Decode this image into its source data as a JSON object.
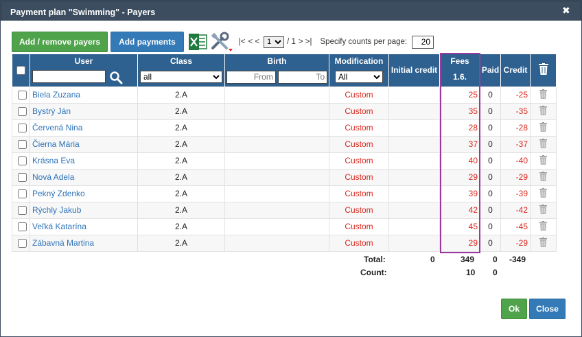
{
  "dialog": {
    "title": "Payment plan \"Swimming\" - Payers",
    "close_glyph": "✖"
  },
  "toolbar": {
    "add_remove_label": "Add / remove payers",
    "add_payments_label": "Add payments",
    "pager": {
      "first": "|<",
      "prev": "< <",
      "page_value": "1",
      "of": "/ 1",
      "next": "> >|"
    },
    "per_page_label": "Specify counts per page:",
    "per_page_value": "20"
  },
  "columns": {
    "user": "User",
    "class": "Class",
    "birth": "Birth",
    "modification": "Modification",
    "initial_credit": "Initial credit",
    "fees": "Fees",
    "fees_date": "1.6.",
    "paid": "Paid",
    "credit": "Credit"
  },
  "filters": {
    "class_value": "all",
    "birth_from_placeholder": "From",
    "birth_to_placeholder": "To",
    "modification_value": "All"
  },
  "rows": [
    {
      "user": "Biela Zuzana",
      "class": "2.A",
      "modification": "Custom",
      "fees": "25",
      "paid": "0",
      "credit": "-25"
    },
    {
      "user": "Bystrý Ján",
      "class": "2.A",
      "modification": "Custom",
      "fees": "35",
      "paid": "0",
      "credit": "-35"
    },
    {
      "user": "Červená Nina",
      "class": "2.A",
      "modification": "Custom",
      "fees": "28",
      "paid": "0",
      "credit": "-28"
    },
    {
      "user": "Čierna Mária",
      "class": "2.A",
      "modification": "Custom",
      "fees": "37",
      "paid": "0",
      "credit": "-37"
    },
    {
      "user": "Krásna Eva",
      "class": "2.A",
      "modification": "Custom",
      "fees": "40",
      "paid": "0",
      "credit": "-40"
    },
    {
      "user": "Nová Adela",
      "class": "2.A",
      "modification": "Custom",
      "fees": "29",
      "paid": "0",
      "credit": "-29"
    },
    {
      "user": "Pekný Zdenko",
      "class": "2.A",
      "modification": "Custom",
      "fees": "39",
      "paid": "0",
      "credit": "-39"
    },
    {
      "user": "Rýchly Jakub",
      "class": "2.A",
      "modification": "Custom",
      "fees": "42",
      "paid": "0",
      "credit": "-42"
    },
    {
      "user": "Veľká Katarína",
      "class": "2.A",
      "modification": "Custom",
      "fees": "45",
      "paid": "0",
      "credit": "-45"
    },
    {
      "user": "Zábavná Martina",
      "class": "2.A",
      "modification": "Custom",
      "fees": "29",
      "paid": "0",
      "credit": "-29"
    }
  ],
  "totals": {
    "total_label": "Total:",
    "total_initial": "0",
    "total_fees": "349",
    "total_paid": "0",
    "total_credit": "-349",
    "count_label": "Count:",
    "count_fees": "10",
    "count_paid": "0"
  },
  "footer": {
    "ok_label": "Ok",
    "close_label": "Close"
  },
  "colors": {
    "header_bg": "#2e6190",
    "title_bg": "#3c4d5f",
    "negative": "#d9281e",
    "link": "#2e73b8",
    "highlight": "#9a3aa1",
    "green": "#4fa34a",
    "blue": "#337ab7"
  },
  "icons": [
    "excel-icon",
    "tools-icon",
    "search-icon",
    "trash-icon",
    "close-icon"
  ]
}
